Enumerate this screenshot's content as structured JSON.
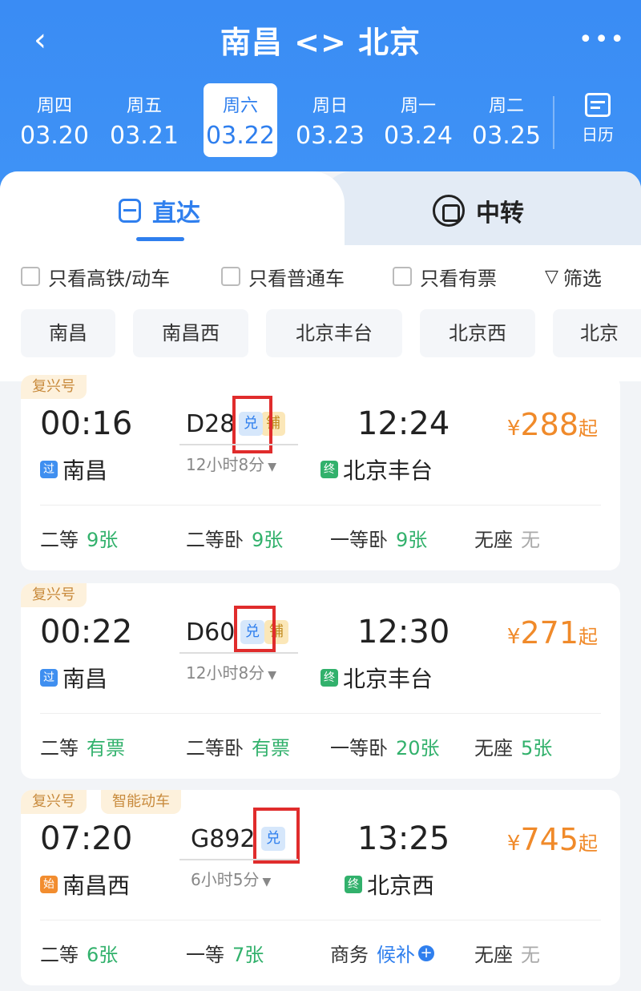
{
  "header": {
    "title": "南昌 <> 北京",
    "back_icon": "chevron-left-icon",
    "more_icon": "more-icon"
  },
  "dates": [
    {
      "week": "周四",
      "day": "03.20",
      "active": false
    },
    {
      "week": "周五",
      "day": "03.21",
      "active": false
    },
    {
      "week": "周六",
      "day": "03.22",
      "active": true
    },
    {
      "week": "周日",
      "day": "03.23",
      "active": false
    },
    {
      "week": "周一",
      "day": "03.24",
      "active": false
    },
    {
      "week": "周二",
      "day": "03.25",
      "active": false
    }
  ],
  "calendar": {
    "label": "日历"
  },
  "tabs": {
    "direct": "直达",
    "transfer": "中转"
  },
  "filters": {
    "high_speed": "只看高铁/动车",
    "normal": "只看普通车",
    "has_ticket": "只看有票",
    "filter": "筛选"
  },
  "stations": [
    "南昌",
    "南昌西",
    "北京丰台",
    "北京西",
    "北京"
  ],
  "trains": [
    {
      "tags": [
        "复兴号"
      ],
      "depart_time": "00:16",
      "depart_badge": "过",
      "depart_station": "南昌",
      "train_no": "D28",
      "badges": [
        "兑",
        "铺"
      ],
      "duration": "12小时8分",
      "arrive_time": "12:24",
      "arrive_badge": "终",
      "arrive_station": "北京丰台",
      "price_symbol": "¥",
      "price": "288",
      "price_suffix": "起",
      "seats": [
        {
          "type": "二等",
          "count": "9张"
        },
        {
          "type": "二等卧",
          "count": "9张"
        },
        {
          "type": "一等卧",
          "count": "9张"
        },
        {
          "type": "无座",
          "count": "无"
        }
      ]
    },
    {
      "tags": [
        "复兴号"
      ],
      "depart_time": "00:22",
      "depart_badge": "过",
      "depart_station": "南昌",
      "train_no": "D60",
      "badges": [
        "兑",
        "铺"
      ],
      "duration": "12小时8分",
      "arrive_time": "12:30",
      "arrive_badge": "终",
      "arrive_station": "北京丰台",
      "price_symbol": "¥",
      "price": "271",
      "price_suffix": "起",
      "seats": [
        {
          "type": "二等",
          "count": "有票"
        },
        {
          "type": "二等卧",
          "count": "有票"
        },
        {
          "type": "一等卧",
          "count": "20张"
        },
        {
          "type": "无座",
          "count": "5张"
        }
      ]
    },
    {
      "tags": [
        "复兴号",
        "智能动车"
      ],
      "depart_time": "07:20",
      "depart_badge": "始",
      "depart_station": "南昌西",
      "train_no": "G892",
      "badges": [
        "兑"
      ],
      "duration": "6小时5分",
      "arrive_time": "13:25",
      "arrive_badge": "终",
      "arrive_station": "北京西",
      "price_symbol": "¥",
      "price": "745",
      "price_suffix": "起",
      "seats": [
        {
          "type": "二等",
          "count": "6张"
        },
        {
          "type": "一等",
          "count": "7张"
        },
        {
          "type": "商务",
          "count": "候补"
        },
        {
          "type": "无座",
          "count": "无"
        }
      ]
    }
  ],
  "colors": {
    "header_blue": "#3a8cf4",
    "accent_blue": "#2f7fee",
    "price_orange": "#f08a2a",
    "available_green": "#32b16c",
    "highlight_red": "#e02c2c"
  }
}
